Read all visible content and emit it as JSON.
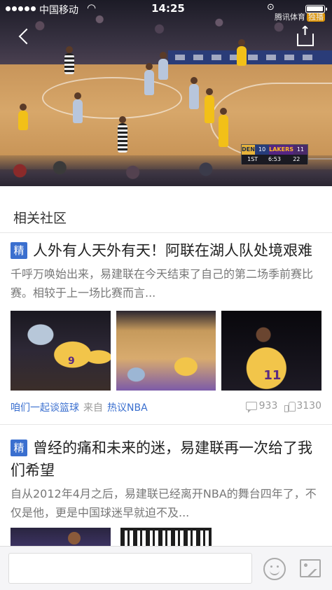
{
  "status_bar": {
    "carrier": "中国移动",
    "time": "14:25",
    "wifi_icon": "wifi-icon",
    "battery_icon": "battery-icon"
  },
  "video": {
    "watermark": "腾讯体育",
    "watermark_tag": "独播",
    "scorebug": {
      "team1": "DEN",
      "score1": "10",
      "team2": "LAKERS",
      "score2": "11",
      "quarter": "1ST",
      "clock": "6:53",
      "shot_clock": "22"
    },
    "back_icon": "back-arrow-icon",
    "share_icon": "share-icon"
  },
  "section": {
    "title": "相关社区"
  },
  "posts": [
    {
      "badge": "精",
      "title": "人外有人天外有天！阿联在湖人队处境艰难",
      "summary": "千呼万唤始出来，易建联在今天结束了自己的第二场季前赛比赛。相较于上一场比赛而言...",
      "community": "咱们一起谈篮球",
      "from_label": "来自",
      "forum": "热议NBA",
      "comments": "933",
      "likes": "3130"
    },
    {
      "badge": "精",
      "title": "曾经的痛和未来的迷，易建联再一次给了我们希望",
      "summary": "自从2012年4月之后，易建联已经离开NBA的舞台四年了，不仅是他，更是中国球迷早就迫不及..."
    }
  ],
  "bottom_bar": {
    "input_value": "",
    "input_placeholder": "",
    "emoji_icon": "emoji-icon",
    "image_icon": "image-icon"
  }
}
